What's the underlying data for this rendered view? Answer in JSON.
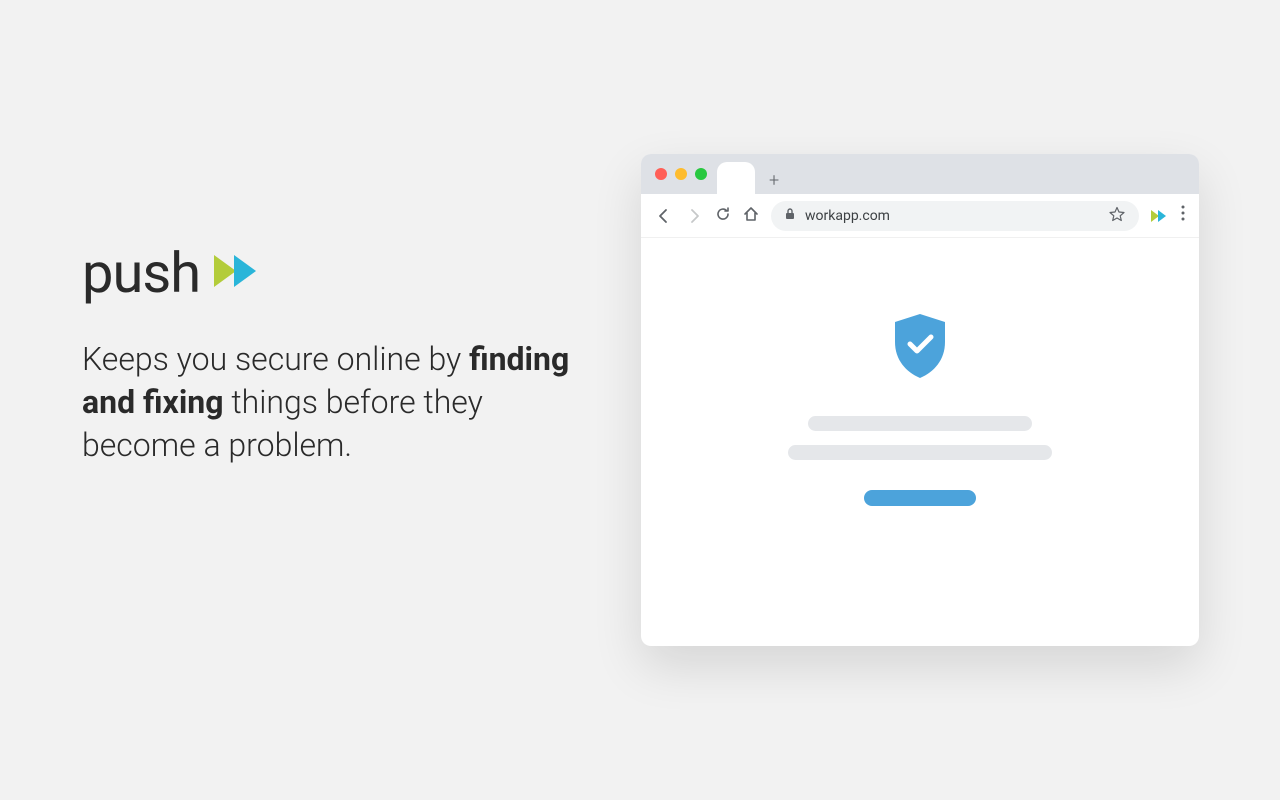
{
  "brand": {
    "name": "push"
  },
  "tagline": {
    "part1": "Keeps you secure online by ",
    "bold": "finding and fixing",
    "part2": " things before they become a problem."
  },
  "browser": {
    "url": "workapp.com",
    "new_tab_symbol": "+"
  },
  "colors": {
    "accent_green": "#b3cc3a",
    "accent_blue": "#2ab5d9",
    "shield_blue": "#4ca3db"
  }
}
